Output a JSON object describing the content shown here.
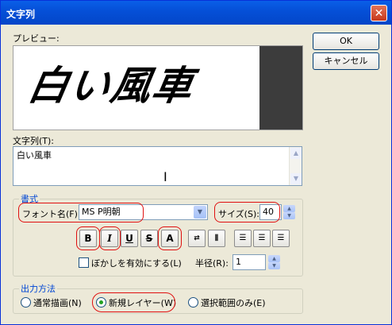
{
  "title": "文字列",
  "labels": {
    "preview": "プレビュー:",
    "text": "文字列(T):",
    "font_name": "フォント名(F):",
    "size": "サイズ(S):",
    "blur": "ぼかしを有効にする(L)",
    "radius": "半径(R):"
  },
  "buttons": {
    "ok": "OK",
    "cancel": "キャンセル"
  },
  "preview_text": "白い風車",
  "text_value": "白い風車",
  "groups": {
    "format": "書式",
    "output": "出力方法"
  },
  "font": {
    "value": "MS P明朝"
  },
  "size": {
    "value": "40"
  },
  "radius": {
    "value": "1"
  },
  "style_buttons": {
    "bold": "B",
    "italic": "I",
    "underline": "U",
    "strike": "S",
    "color": "A"
  },
  "output": {
    "normal": "通常描画(N)",
    "new_layer": "新規レイヤー(W)",
    "selection": "選択範囲のみ(E)",
    "selected": "new_layer"
  },
  "colors": {
    "accent": "#0046d5",
    "highlight": "#e01010"
  }
}
